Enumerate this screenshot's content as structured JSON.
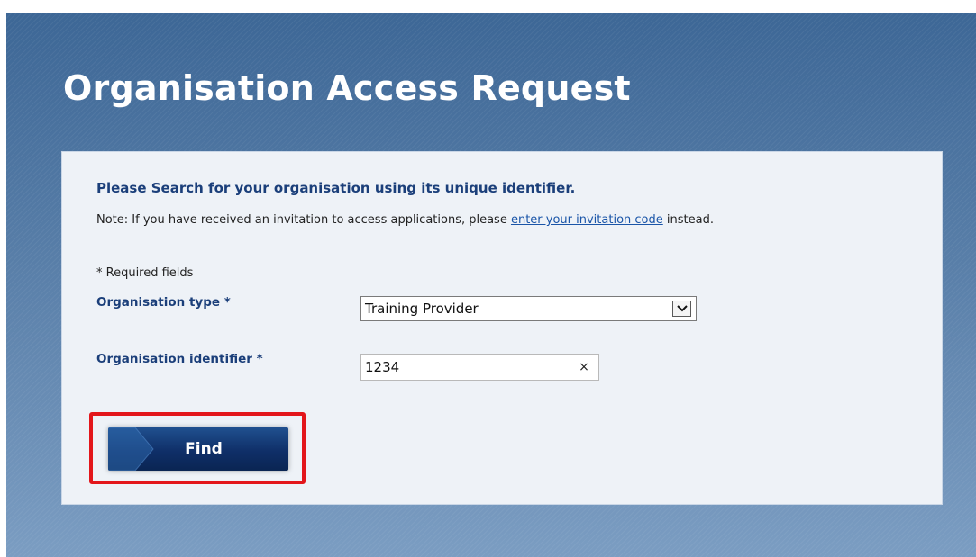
{
  "page": {
    "title": "Organisation Access Request"
  },
  "form": {
    "heading": "Please Search for your organisation using its unique identifier.",
    "note_prefix": "Note: If you have received an invitation to access applications, please ",
    "note_link": "enter your invitation code",
    "note_suffix": " instead.",
    "required_note": "* Required fields",
    "org_type_label": "Organisation type *",
    "org_type_value": "Training Provider",
    "org_id_label": "Organisation identifier *",
    "org_id_value": "1234",
    "clear_glyph": "×",
    "find_label": "Find"
  },
  "icons": {
    "dropdown": "chevron-down-icon",
    "clear": "close-icon",
    "button_decoration": "chevron-right-icon"
  },
  "colors": {
    "background_top": "#3d6796",
    "background_bottom": "#7b9dc2",
    "panel": "#eef2f7",
    "heading_text": "#1b3f7a",
    "link": "#1a55a8",
    "button": "#0f2f68",
    "highlight": "#e3161b"
  }
}
